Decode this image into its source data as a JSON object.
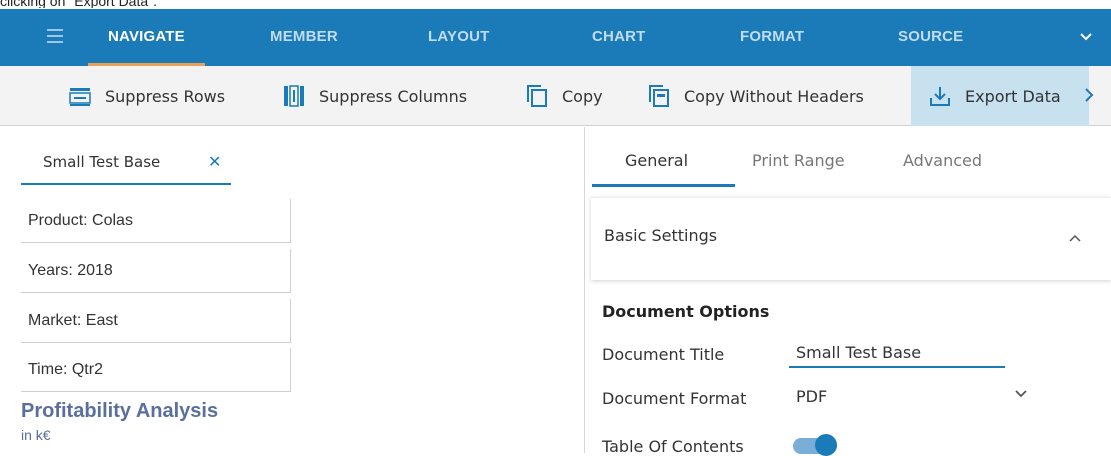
{
  "caption": "clicking on \"Export Data\".",
  "nav": {
    "tabs": [
      "NAVIGATE",
      "MEMBER",
      "LAYOUT",
      "CHART",
      "FORMAT",
      "SOURCE"
    ],
    "active_tab": "NAVIGATE"
  },
  "toolbar": {
    "suppress_rows": "Suppress Rows",
    "suppress_columns": "Suppress Columns",
    "copy": "Copy",
    "copy_without_headers": "Copy Without Headers",
    "export_data": "Export Data"
  },
  "left": {
    "doc_tab": "Small Test Base",
    "pov": [
      "Product: Colas",
      "Years: 2018",
      "Market: East",
      "Time: Qtr2"
    ],
    "report_title": "Profitability Analysis",
    "report_subtitle": "in k€"
  },
  "right": {
    "tabs": [
      "General",
      "Print Range",
      "Advanced"
    ],
    "active_tab": "General",
    "basic_settings": "Basic Settings",
    "document_options": "Document Options",
    "fields": {
      "title_label": "Document Title",
      "title_value": "Small Test Base",
      "format_label": "Document Format",
      "format_value": "PDF",
      "toc_label": "Table Of Contents",
      "toc_on": true
    }
  },
  "colors": {
    "nav_bg": "#1b7ab8",
    "nav_active_underline": "#e9a255",
    "export_highlight": "#c7e1ef",
    "accent": "#1b7ab8",
    "report_title": "#5b6f9d"
  },
  "icons": [
    "menu-icon",
    "chevron-down-icon",
    "suppress-rows-icon",
    "suppress-columns-icon",
    "copy-icon",
    "copy-without-headers-icon",
    "export-icon",
    "chevron-right-icon",
    "close-icon",
    "chevron-up-icon"
  ]
}
